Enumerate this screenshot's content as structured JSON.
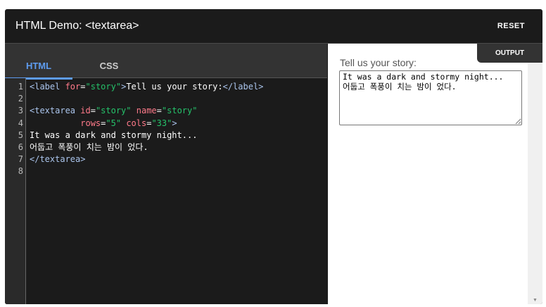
{
  "header": {
    "title": "HTML Demo: <textarea>",
    "reset": "RESET"
  },
  "tabs": {
    "html": "HTML",
    "css": "CSS",
    "output": "OUTPUT"
  },
  "code": {
    "line_numbers": [
      "1",
      "2",
      "3",
      "4",
      "5",
      "6",
      "7",
      "8"
    ]
  },
  "output": {
    "label": "Tell us your story:",
    "textarea_value": "It was a dark and stormy night...\n어둡고 폭풍이 치는 밤이 었다."
  }
}
